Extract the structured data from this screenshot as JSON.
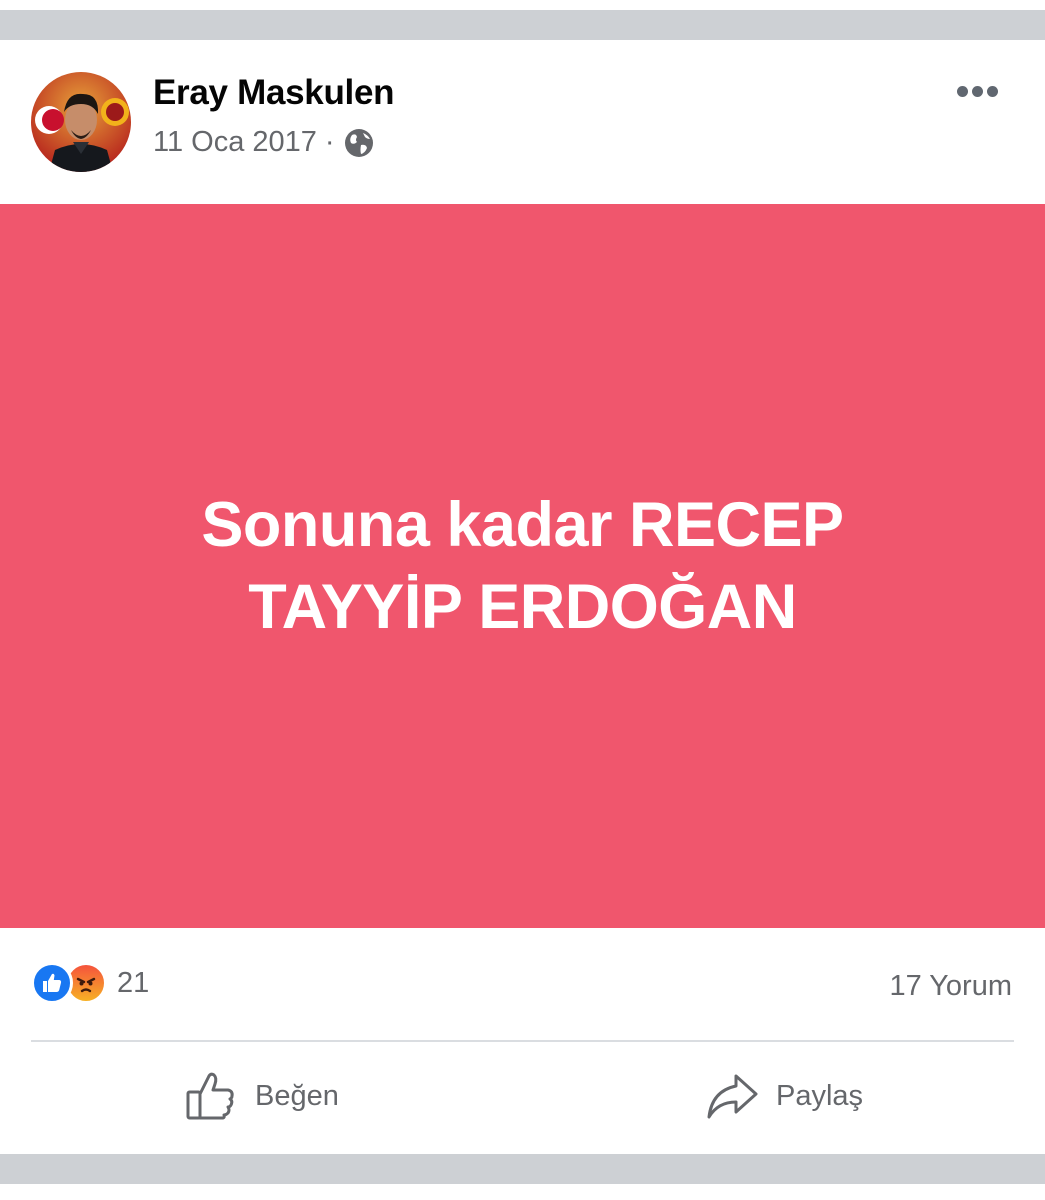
{
  "post": {
    "author": "Eray Maskulen",
    "date": "11 Oca 2017",
    "separator": "·",
    "privacy_icon": "globe-icon",
    "more_icon": "more-horizontal-icon",
    "banner": {
      "text": "Sonuna kadar RECEP TAYYİP ERDOĞAN",
      "background_color": "#f0566d",
      "text_color": "#ffffff"
    },
    "stats": {
      "reaction_icons": [
        "like-reaction-icon",
        "angry-reaction-icon"
      ],
      "reaction_count": "21",
      "comment_count": "17 Yorum"
    },
    "actions": {
      "like_label": "Beğen",
      "share_label": "Paylaş"
    }
  }
}
